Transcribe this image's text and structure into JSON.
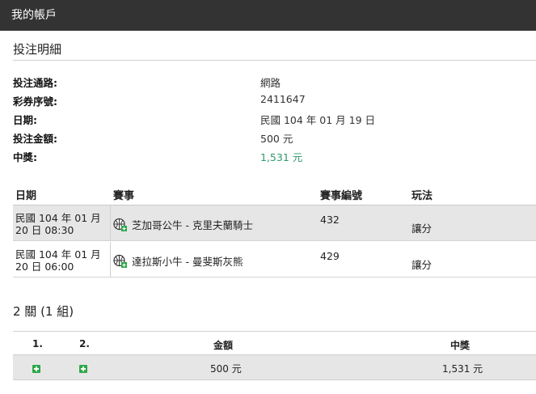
{
  "header": {
    "title": "我的帳戶"
  },
  "section": {
    "title": "投注明細"
  },
  "details": [
    {
      "label": "投注通路:",
      "value": "網路"
    },
    {
      "label": "彩券序號:",
      "value": "2411647"
    },
    {
      "label": "日期:",
      "value": "民國 104 年 01 月 19 日"
    },
    {
      "label": "投注金額:",
      "value": "500 元"
    },
    {
      "label": "中獎:",
      "value": "1,531 元"
    }
  ],
  "bets_table": {
    "headers": [
      "日期",
      "賽事",
      "賽事編號",
      "玩法"
    ],
    "rows": [
      {
        "date_line1": "民國 104 年 01 月",
        "date_line2": "20 日 08:30",
        "event": "芝加哥公牛 - 克里夫蘭騎士",
        "event_icon": "basketball-icon",
        "number": "432",
        "play": "讓分"
      },
      {
        "date_line1": "民國 104 年 01 月",
        "date_line2": "20 日 06:00",
        "event": "達拉斯小牛 - 曼斐斯灰熊",
        "event_icon": "basketball-icon",
        "number": "429",
        "play": "讓分"
      }
    ]
  },
  "combo": {
    "title": "2 關 (1 組)",
    "headers": [
      "1.",
      "2.",
      "金額",
      "中獎"
    ],
    "row": {
      "amount": "500 元",
      "prize": "1,531 元"
    }
  },
  "colors": {
    "header_bg": "#333333",
    "win_green": "#2e9a6a",
    "plus_green": "#2ea84a",
    "row_alt": "#e6e6e6"
  }
}
